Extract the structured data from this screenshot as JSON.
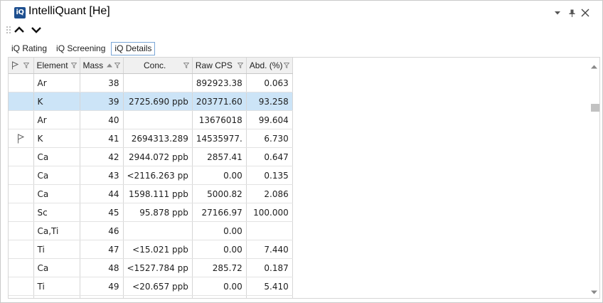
{
  "window": {
    "icon_text": "iQ",
    "title": "IntelliQuant [He]"
  },
  "tabs": [
    {
      "label": "iQ Rating",
      "active": false
    },
    {
      "label": "iQ Screening",
      "active": false
    },
    {
      "label": "iQ Details",
      "active": true
    }
  ],
  "grid": {
    "columns": [
      {
        "key": "flag",
        "label": "",
        "icon": "flag-icon",
        "filter": true
      },
      {
        "key": "element",
        "label": "Element",
        "filter": true
      },
      {
        "key": "mass",
        "label": "Mass",
        "sort": "ascending",
        "filter": true
      },
      {
        "key": "conc",
        "label": "Conc.",
        "filter": true
      },
      {
        "key": "raw_cps",
        "label": "Raw CPS",
        "filter": true
      },
      {
        "key": "abd",
        "label": "Abd. (%)",
        "filter": true
      }
    ],
    "rows": [
      {
        "flag": false,
        "element": "Ar",
        "mass": "38",
        "conc": "",
        "raw_cps": "892923.38",
        "abd": "0.063",
        "selected": false
      },
      {
        "flag": false,
        "element": "K",
        "mass": "39",
        "conc": "2725.690 ppb",
        "raw_cps": "203771.60",
        "abd": "93.258",
        "selected": true
      },
      {
        "flag": false,
        "element": "Ar",
        "mass": "40",
        "conc": "",
        "raw_cps": "13676018",
        "abd": "99.604",
        "selected": false
      },
      {
        "flag": true,
        "element": "K",
        "mass": "41",
        "conc": "2694313.289",
        "raw_cps": "14535977.",
        "abd": "6.730",
        "selected": false
      },
      {
        "flag": false,
        "element": "Ca",
        "mass": "42",
        "conc": "2944.072 ppb",
        "raw_cps": "2857.41",
        "abd": "0.647",
        "selected": false
      },
      {
        "flag": false,
        "element": "Ca",
        "mass": "43",
        "conc": "<2116.263 pp",
        "raw_cps": "0.00",
        "abd": "0.135",
        "selected": false
      },
      {
        "flag": false,
        "element": "Ca",
        "mass": "44",
        "conc": "1598.111 ppb",
        "raw_cps": "5000.82",
        "abd": "2.086",
        "selected": false
      },
      {
        "flag": false,
        "element": "Sc",
        "mass": "45",
        "conc": "95.878 ppb",
        "raw_cps": "27166.97",
        "abd": "100.000",
        "selected": false
      },
      {
        "flag": false,
        "element": "Ca,Ti",
        "mass": "46",
        "conc": "",
        "raw_cps": "0.00",
        "abd": "",
        "selected": false
      },
      {
        "flag": false,
        "element": "Ti",
        "mass": "47",
        "conc": "<15.021 ppb",
        "raw_cps": "0.00",
        "abd": "7.440",
        "selected": false
      },
      {
        "flag": false,
        "element": "Ca",
        "mass": "48",
        "conc": "<1527.784 pp",
        "raw_cps": "285.72",
        "abd": "0.187",
        "selected": false
      },
      {
        "flag": false,
        "element": "Ti",
        "mass": "49",
        "conc": "<20.657 ppb",
        "raw_cps": "0.00",
        "abd": "5.410",
        "selected": false
      }
    ]
  },
  "colors": {
    "selection": "#cce4f7",
    "header_bg": "#f0f0f0",
    "app_icon": "#1e4f8f",
    "active_tab_border": "#7aa6d6"
  }
}
